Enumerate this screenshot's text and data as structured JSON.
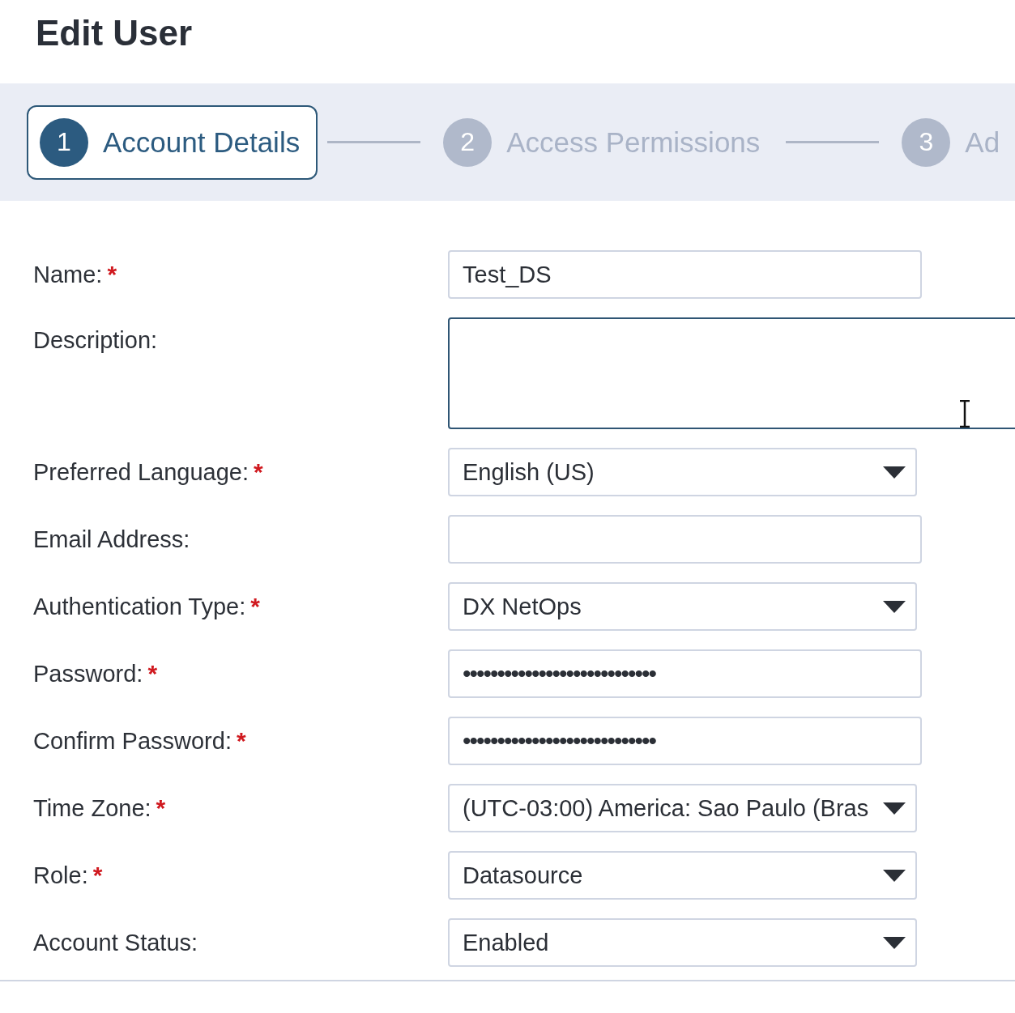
{
  "title": "Edit User",
  "steps": [
    {
      "number": "1",
      "label": "Account Details",
      "selected": true
    },
    {
      "number": "2",
      "label": "Access Permissions",
      "selected": false
    },
    {
      "number": "3",
      "label": "Ad",
      "selected": false
    }
  ],
  "fields": [
    {
      "label": "Name:",
      "required_mark": "*",
      "kind": "text",
      "value": "Test_DS",
      "focused": false
    },
    {
      "label": "Description:",
      "kind": "textarea",
      "focused": true
    },
    {
      "label": "Preferred Language:",
      "required_mark": "*",
      "kind": "select",
      "value": "English (US)",
      "focused": false
    },
    {
      "label": "Email Address:",
      "kind": "text",
      "focused": false
    },
    {
      "label": "Authentication Type:",
      "required_mark": "*",
      "kind": "select",
      "value": "DX NetOps",
      "focused": false
    },
    {
      "label": "Password:",
      "required_mark": "*",
      "kind": "password",
      "value": "••••••••••••••••••••••••••••",
      "focused": false
    },
    {
      "label": "Confirm Password:",
      "required_mark": "*",
      "kind": "password",
      "value": "••••••••••••••••••••••••••••",
      "focused": false
    },
    {
      "label": "Time Zone:",
      "required_mark": "*",
      "kind": "select",
      "value": "(UTC-03:00) America: Sao Paulo (Bras",
      "focused": false
    },
    {
      "label": "Role:",
      "required_mark": "*",
      "kind": "select",
      "value": "Datasource",
      "focused": false
    },
    {
      "label": "Account Status:",
      "kind": "select",
      "value": "Enabled",
      "focused": false
    }
  ]
}
